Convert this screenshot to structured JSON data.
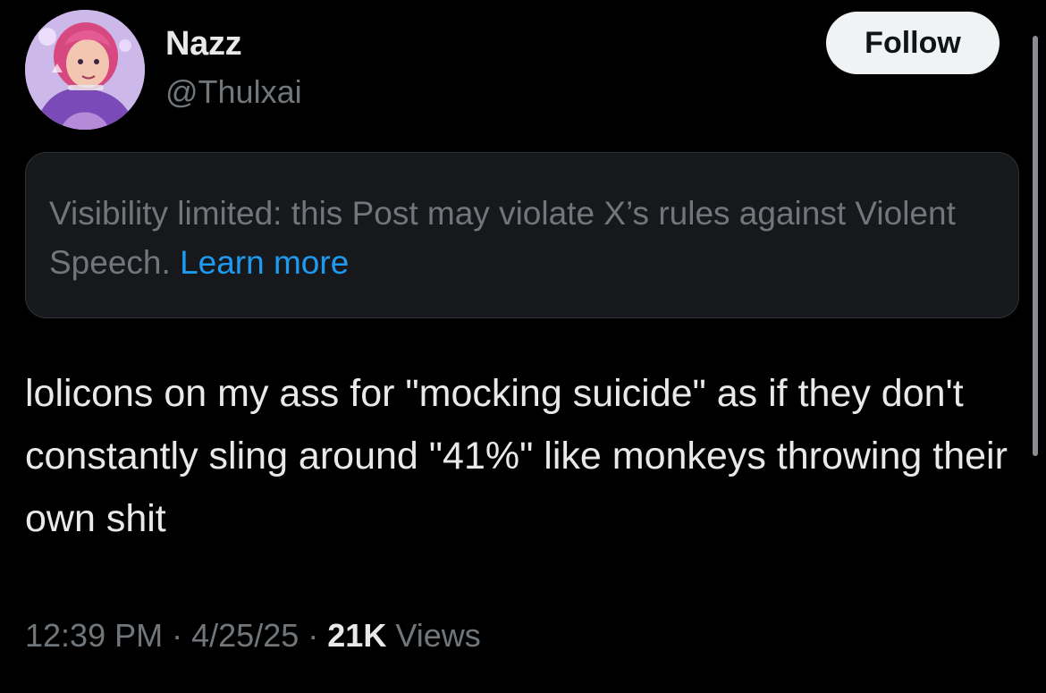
{
  "author": {
    "display_name": "Nazz",
    "handle": "@Thulxai"
  },
  "follow_button": {
    "label": "Follow"
  },
  "notice": {
    "text": "Visibility limited: this Post may violate X’s rules against Violent Speech.",
    "link_label": "Learn more"
  },
  "post": {
    "text": "lolicons on my ass for \"mocking suicide\" as if they don't constantly sling around \"41%\" like monkeys throwing their own shit"
  },
  "meta": {
    "time": "12:39 PM",
    "separator": "·",
    "date": "4/25/25",
    "views_count": "21K",
    "views_label": "Views"
  },
  "colors": {
    "background": "#000000",
    "primary_text": "#e7e9ea",
    "secondary_text": "#71767b",
    "link": "#1d9bf0",
    "notice_bg": "#16181c",
    "button_bg": "#eff3f4"
  }
}
